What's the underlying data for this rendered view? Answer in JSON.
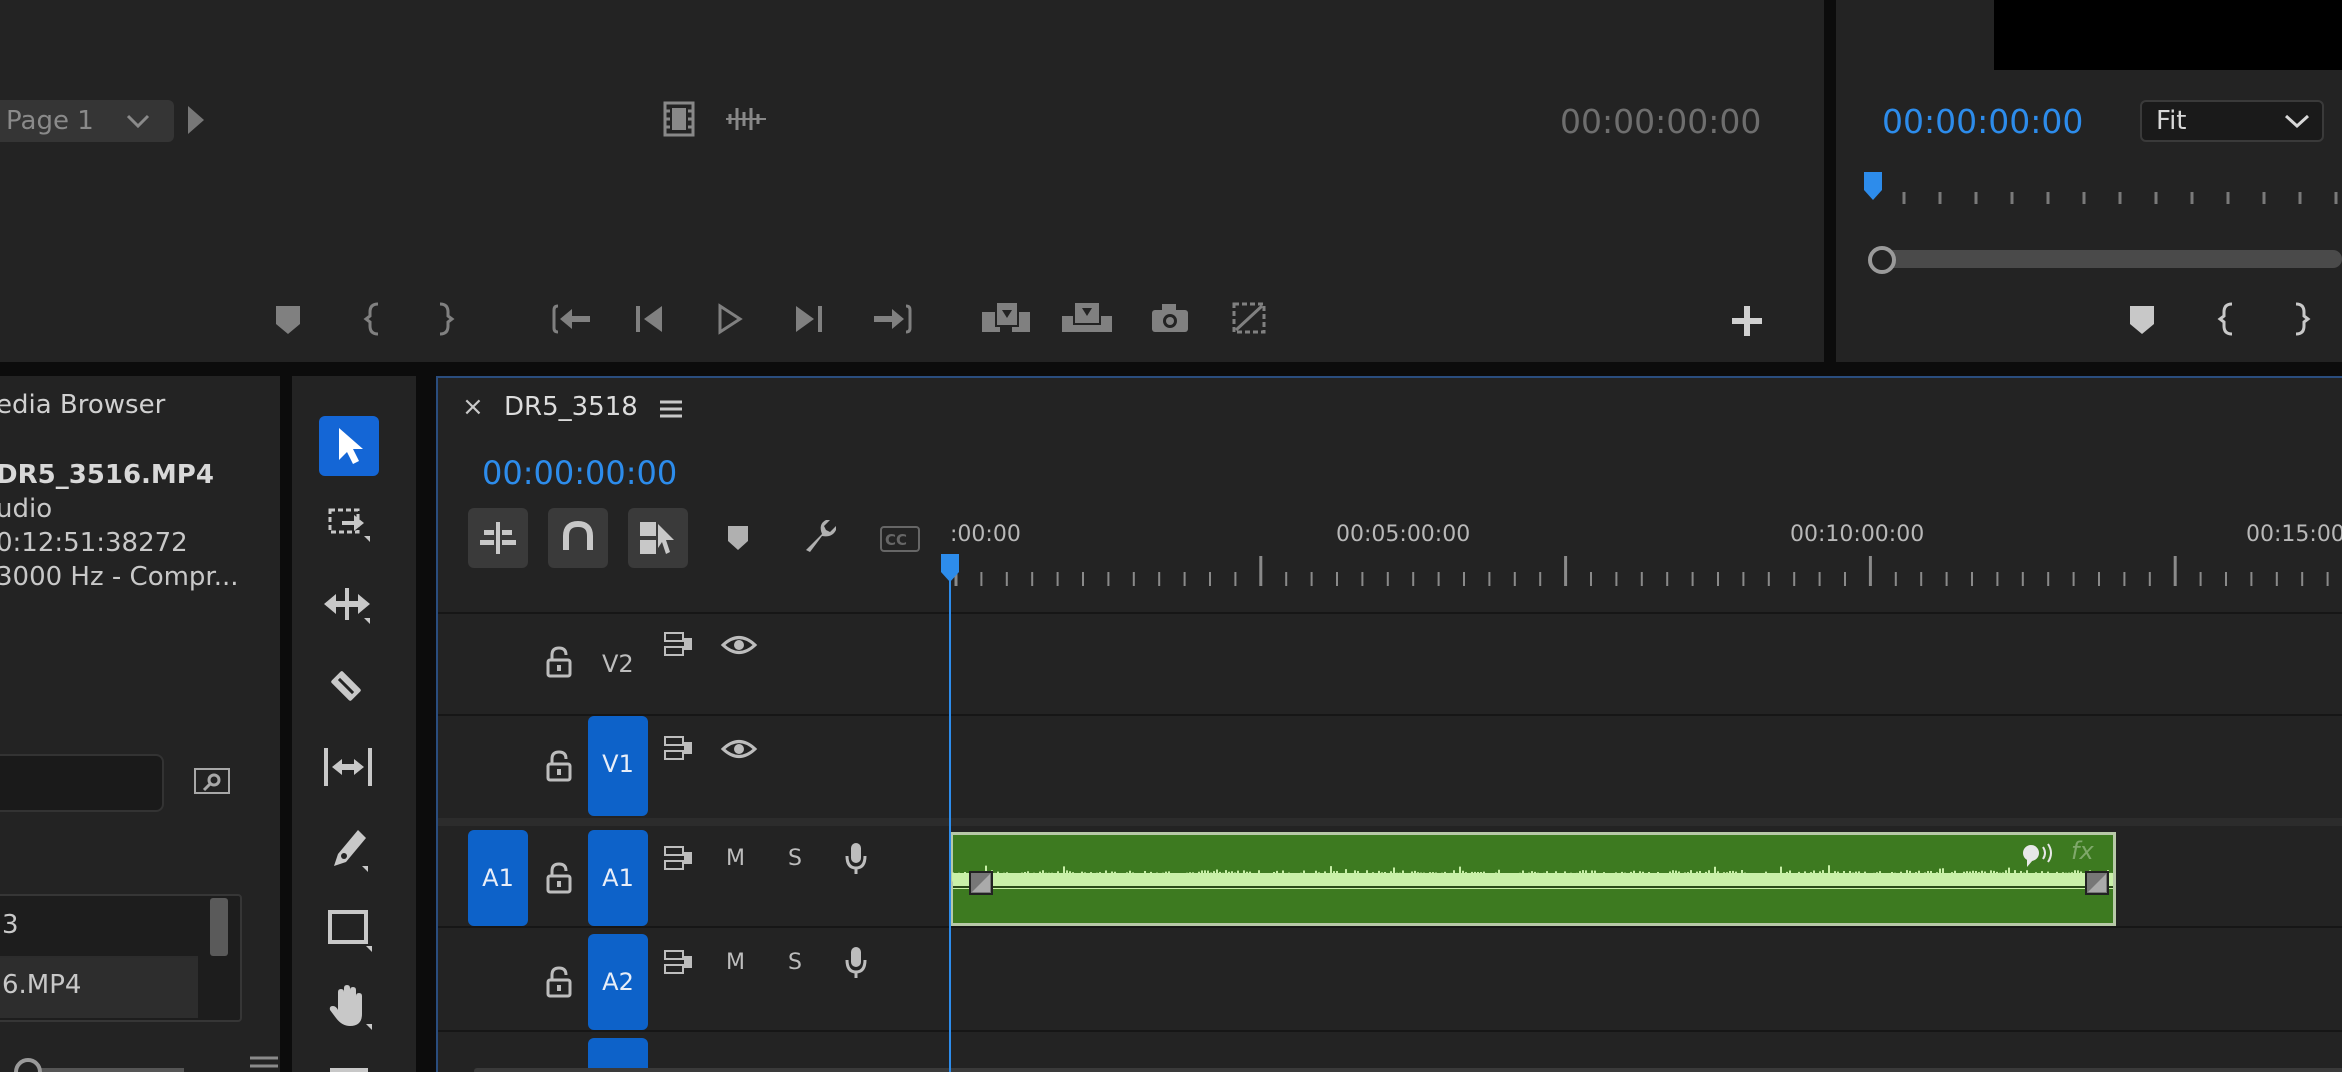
{
  "source_monitor": {
    "page_dropdown": "Page 1",
    "timecode": "00:00:00:00"
  },
  "program_monitor": {
    "timecode": "00:00:00:00",
    "zoom": "Fit"
  },
  "media_browser": {
    "title": "edia Browser",
    "file_name": "DR5_3516.MP4",
    "file_type": "udio",
    "duration": "0:12:51:38272",
    "audio_info": "3000 Hz - Compr...",
    "list_item_1": "3",
    "list_item_2": "6.MP4"
  },
  "timeline": {
    "tab_close": "×",
    "sequence_name": "DR5_3518",
    "timecode": "00:00:00:00",
    "ruler_labels": [
      ":00:00",
      "00:05:00:00",
      "00:10:00:00",
      "00:15:00"
    ],
    "tracks": {
      "v2": "V2",
      "v1": "V1",
      "a1_source": "A1",
      "a1": "A1",
      "a2": "A2",
      "mute": "M",
      "solo": "S"
    },
    "clip_fx": "fx"
  },
  "colors": {
    "accent_blue": "#2d8ceb",
    "track_blue": "#0d62c9",
    "clip_green": "#3d7a20",
    "waveform": "#c9f0a8"
  }
}
